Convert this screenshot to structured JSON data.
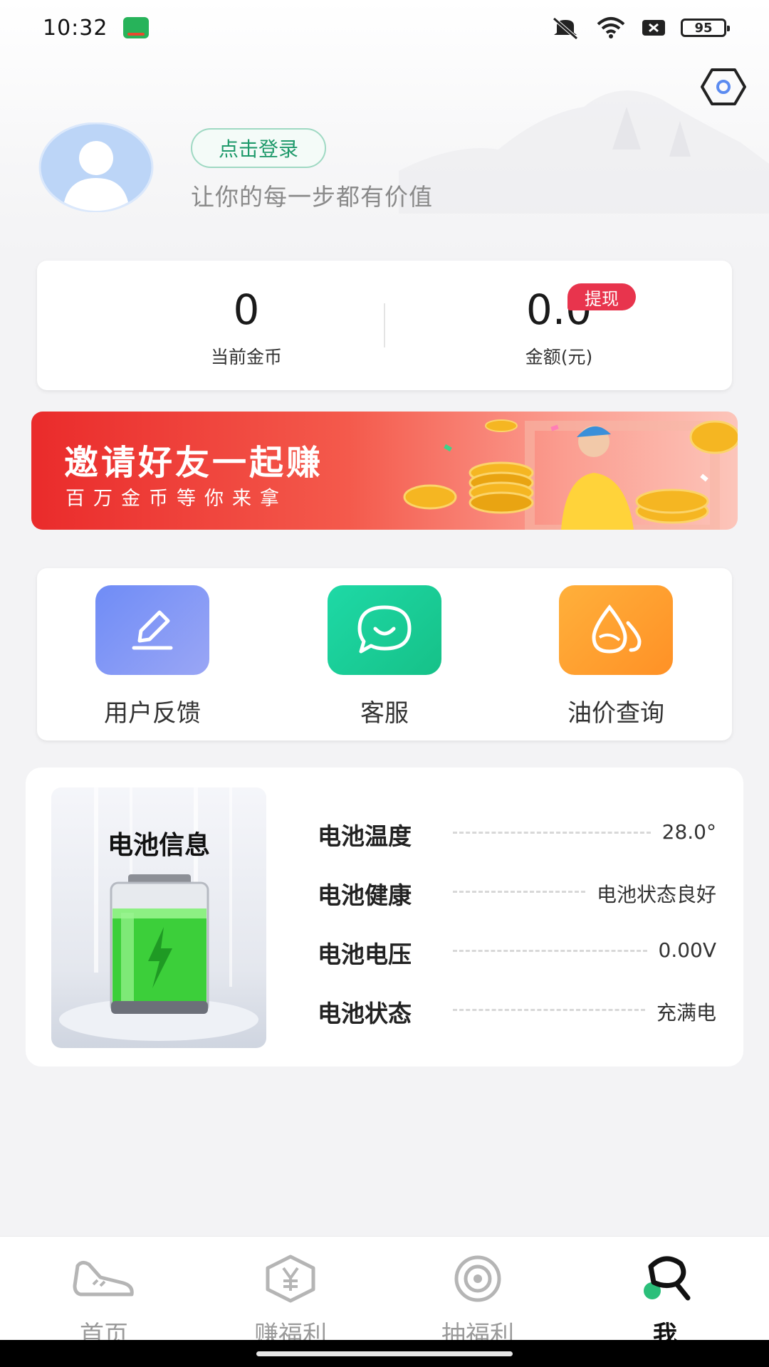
{
  "status_bar": {
    "time": "10:32",
    "battery_level": "95",
    "icons": [
      "mute-icon",
      "wifi-icon",
      "no-sim-icon",
      "battery-icon"
    ]
  },
  "profile": {
    "login_label": "点击登录",
    "slogan": "让你的每一步都有价值"
  },
  "stats": {
    "coins_value": "0",
    "coins_label": "当前金币",
    "money_value": "0.0",
    "money_label": "金额(元)",
    "withdraw_label": "提现"
  },
  "invite_banner": {
    "title": "邀请好友一起赚",
    "subtitle": "百万金币等你来拿"
  },
  "tools": [
    {
      "label": "用户反馈",
      "icon": "pencil-icon"
    },
    {
      "label": "客服",
      "icon": "chat-smile-icon"
    },
    {
      "label": "油价查询",
      "icon": "oil-drop-icon"
    }
  ],
  "battery": {
    "title": "电池信息",
    "rows": [
      {
        "label": "电池温度",
        "value": "28.0°"
      },
      {
        "label": "电池健康",
        "value": "电池状态良好"
      },
      {
        "label": "电池电压",
        "value": "0.00V"
      },
      {
        "label": "电池状态",
        "value": "充满电"
      }
    ]
  },
  "bottom_nav": {
    "items": [
      {
        "label": "首页",
        "icon": "shoe-icon"
      },
      {
        "label": "赚福利",
        "icon": "yuan-hexagon-icon"
      },
      {
        "label": "抽福利",
        "icon": "lottery-icon"
      },
      {
        "label": "我",
        "icon": "profile-icon"
      }
    ],
    "active": "我"
  },
  "colors": {
    "accent_green": "#1f9a6b",
    "withdraw_red": "#e8344d",
    "banner_red": "#ea2b2b"
  }
}
